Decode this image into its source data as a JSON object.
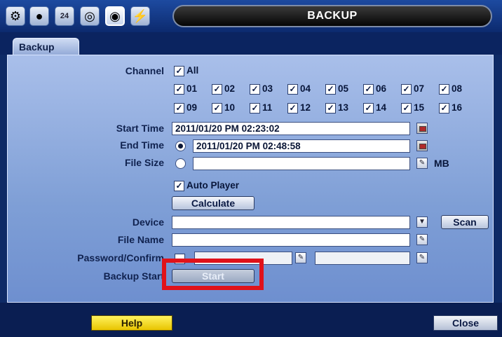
{
  "window": {
    "title": "BACKUP"
  },
  "toolbar": {
    "icons": [
      "gear-icon",
      "camera-icon",
      "calendar-icon",
      "network-icon",
      "disk-icon",
      "power-icon"
    ],
    "calendar_day": "24"
  },
  "tab": {
    "label": "Backup"
  },
  "form": {
    "channel_label": "Channel",
    "all_label": "All",
    "channels": [
      "01",
      "02",
      "03",
      "04",
      "05",
      "06",
      "07",
      "08",
      "09",
      "10",
      "11",
      "12",
      "13",
      "14",
      "15",
      "16"
    ],
    "start_time_label": "Start Time",
    "start_time_value": "2011/01/20 PM 02:23:02",
    "end_time_label": "End Time",
    "end_time_value": "2011/01/20 PM 02:48:58",
    "file_size_label": "File Size",
    "file_size_value": "",
    "file_size_unit": "MB",
    "auto_player_label": "Auto Player",
    "calculate_label": "Calculate",
    "device_label": "Device",
    "device_value": "",
    "scan_label": "Scan",
    "file_name_label": "File Name",
    "file_name_value": "",
    "password_label": "Password/Confirm",
    "backup_start_label": "Backup Start",
    "start_label": "Start"
  },
  "footer": {
    "help_label": "Help",
    "close_label": "Close"
  },
  "colors": {
    "highlight": "#e0121a",
    "help_button": "#ffe600",
    "panel": "#8fa9dc"
  }
}
